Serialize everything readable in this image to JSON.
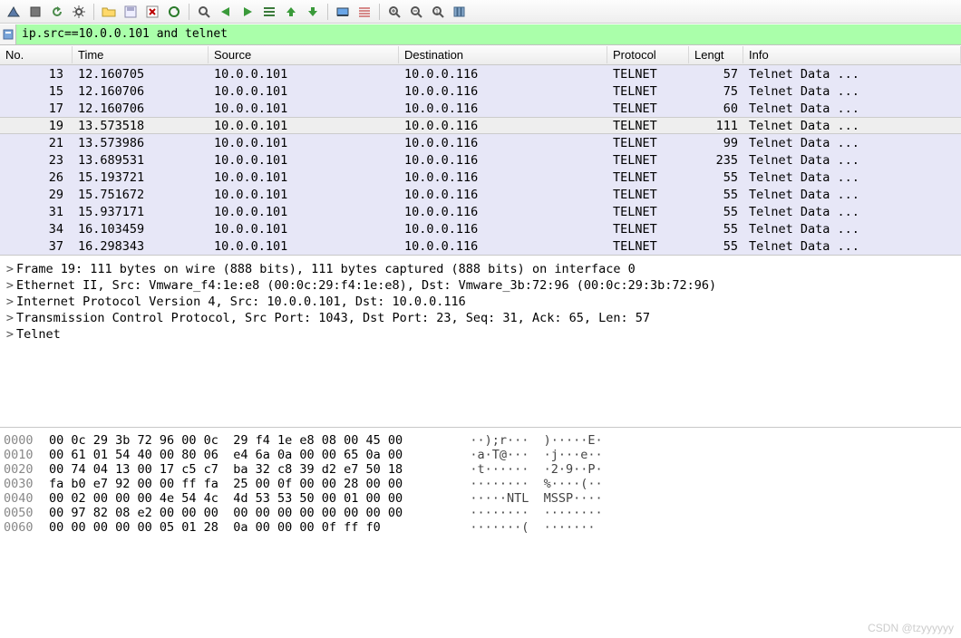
{
  "toolbar_icons": [
    "shark-fin-icon",
    "square-stop-icon",
    "refresh-icon",
    "gear-icon",
    "sep",
    "folder-open-icon",
    "save-icon",
    "close-x-icon",
    "reload-circle-icon",
    "sep",
    "find-icon",
    "arrow-left-green-icon",
    "arrow-right-green-icon",
    "goto-list-icon",
    "arrow-up-icon",
    "arrow-down-icon",
    "sep",
    "blue-box-icon",
    "lines-icon",
    "sep",
    "zoom-in-icon",
    "zoom-out-icon",
    "zoom-reset-icon",
    "columns-icon"
  ],
  "filter": {
    "value": "ip.src==10.0.0.101 and telnet"
  },
  "columns": [
    "No.",
    "Time",
    "Source",
    "Destination",
    "Protocol",
    "Lengt",
    "Info"
  ],
  "packets": [
    {
      "no": "13",
      "time": "12.160705",
      "src": "10.0.0.101",
      "dst": "10.0.0.116",
      "proto": "TELNET",
      "len": "57",
      "info": "Telnet Data ..."
    },
    {
      "no": "15",
      "time": "12.160706",
      "src": "10.0.0.101",
      "dst": "10.0.0.116",
      "proto": "TELNET",
      "len": "75",
      "info": "Telnet Data ..."
    },
    {
      "no": "17",
      "time": "12.160706",
      "src": "10.0.0.101",
      "dst": "10.0.0.116",
      "proto": "TELNET",
      "len": "60",
      "info": "Telnet Data ..."
    },
    {
      "no": "19",
      "time": "13.573518",
      "src": "10.0.0.101",
      "dst": "10.0.0.116",
      "proto": "TELNET",
      "len": "111",
      "info": "Telnet Data ...",
      "sel": true
    },
    {
      "no": "21",
      "time": "13.573986",
      "src": "10.0.0.101",
      "dst": "10.0.0.116",
      "proto": "TELNET",
      "len": "99",
      "info": "Telnet Data ..."
    },
    {
      "no": "23",
      "time": "13.689531",
      "src": "10.0.0.101",
      "dst": "10.0.0.116",
      "proto": "TELNET",
      "len": "235",
      "info": "Telnet Data ..."
    },
    {
      "no": "26",
      "time": "15.193721",
      "src": "10.0.0.101",
      "dst": "10.0.0.116",
      "proto": "TELNET",
      "len": "55",
      "info": "Telnet Data ..."
    },
    {
      "no": "29",
      "time": "15.751672",
      "src": "10.0.0.101",
      "dst": "10.0.0.116",
      "proto": "TELNET",
      "len": "55",
      "info": "Telnet Data ..."
    },
    {
      "no": "31",
      "time": "15.937171",
      "src": "10.0.0.101",
      "dst": "10.0.0.116",
      "proto": "TELNET",
      "len": "55",
      "info": "Telnet Data ..."
    },
    {
      "no": "34",
      "time": "16.103459",
      "src": "10.0.0.101",
      "dst": "10.0.0.116",
      "proto": "TELNET",
      "len": "55",
      "info": "Telnet Data ..."
    },
    {
      "no": "37",
      "time": "16.298343",
      "src": "10.0.0.101",
      "dst": "10.0.0.116",
      "proto": "TELNET",
      "len": "55",
      "info": "Telnet Data ..."
    }
  ],
  "details": [
    "Frame 19: 111 bytes on wire (888 bits), 111 bytes captured (888 bits) on interface 0",
    "Ethernet II, Src: Vmware_f4:1e:e8 (00:0c:29:f4:1e:e8), Dst: Vmware_3b:72:96 (00:0c:29:3b:72:96)",
    "Internet Protocol Version 4, Src: 10.0.0.101, Dst: 10.0.0.116",
    "Transmission Control Protocol, Src Port: 1043, Dst Port: 23, Seq: 31, Ack: 65, Len: 57",
    "Telnet"
  ],
  "hex": [
    {
      "off": "0000",
      "b": "00 0c 29 3b 72 96 00 0c  29 f4 1e e8 08 00 45 00",
      "a": "··);r···  )·····E·"
    },
    {
      "off": "0010",
      "b": "00 61 01 54 40 00 80 06  e4 6a 0a 00 00 65 0a 00",
      "a": "·a·T@···  ·j···e··"
    },
    {
      "off": "0020",
      "b": "00 74 04 13 00 17 c5 c7  ba 32 c8 39 d2 e7 50 18",
      "a": "·t······  ·2·9··P·"
    },
    {
      "off": "0030",
      "b": "fa b0 e7 92 00 00 ff fa  25 00 0f 00 00 28 00 00",
      "a": "········  %····(··"
    },
    {
      "off": "0040",
      "b": "00 02 00 00 00 4e 54 4c  4d 53 53 50 00 01 00 00",
      "a": "·····NTL  MSSP····"
    },
    {
      "off": "0050",
      "b": "00 97 82 08 e2 00 00 00  00 00 00 00 00 00 00 00",
      "a": "········  ········"
    },
    {
      "off": "0060",
      "b": "00 00 00 00 00 05 01 28  0a 00 00 00 0f ff f0",
      "a": "·······(  ·······"
    }
  ],
  "watermark": "CSDN @tzyyyyyy"
}
